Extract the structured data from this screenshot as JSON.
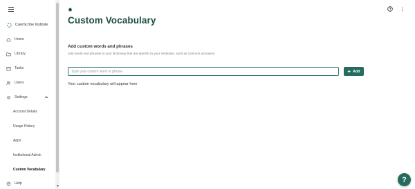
{
  "sidebar": {
    "brand_name": "CareScribe Institute",
    "items": [
      {
        "label": "Home",
        "icon": "home-icon"
      },
      {
        "label": "Library",
        "icon": "folder-icon"
      },
      {
        "label": "Tasks",
        "icon": "calendar-icon"
      },
      {
        "label": "Users",
        "icon": "users-icon"
      },
      {
        "label": "Settings",
        "icon": "gear-icon"
      }
    ],
    "settings_sub_items": [
      {
        "label": "Account Details"
      },
      {
        "label": "Usage History"
      },
      {
        "label": "Apps"
      },
      {
        "label": "Institutional Admin"
      },
      {
        "label": "Custom Vocabulary",
        "active": true
      }
    ],
    "help_label": "Help"
  },
  "header": {
    "breadcrumb_icon": "home-icon",
    "help_icon": "help-circle-icon",
    "menu_icon": "kebab-menu-icon"
  },
  "main": {
    "title": "Custom Vocabulary",
    "section_title": "Add custom words and phrases",
    "section_description": "Add words and phrases to your dictionary that are specific to your institution, such as common acronyms",
    "input_placeholder": "Type your custom word or phrase",
    "input_value": "",
    "add_button_label": "Add",
    "empty_message": "Your custom vocabulary will appear here"
  },
  "fab": {
    "label": "?"
  },
  "colors": {
    "accent": "#256b5e",
    "title": "#1e4d44",
    "input_border": "#2e7a6c"
  }
}
